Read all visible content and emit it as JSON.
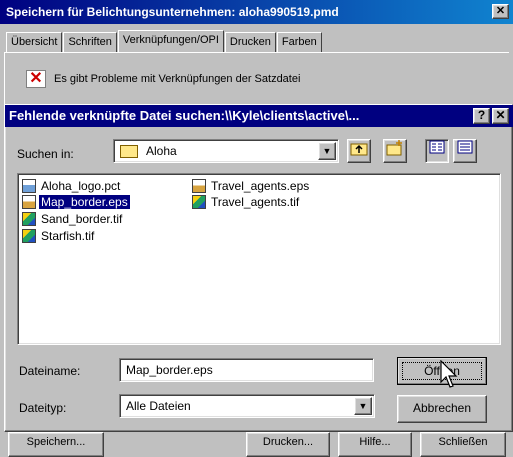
{
  "background_dialog": {
    "title": "Speichern für Belichtungsunternehmen: aloha990519.pmd",
    "close_glyph": "✕",
    "tabs": [
      {
        "label": "Übersicht"
      },
      {
        "label": "Schriften"
      },
      {
        "label": "Verknüpfungen/OPI",
        "active": true
      },
      {
        "label": "Drucken"
      },
      {
        "label": "Farben"
      }
    ],
    "warning_text": "Es gibt Probleme mit Verknüpfungen der Satzdatei",
    "warning_icon": "✕",
    "bottom_buttons": [
      {
        "label": "Speichern..."
      },
      {
        "label": "Drucken..."
      },
      {
        "label": "Hilfe..."
      },
      {
        "label": "Schließen"
      }
    ]
  },
  "dialog": {
    "title": "Fehlende verknüpfte Datei suchen:\\\\Kyle\\clients\\active\\...",
    "help_glyph": "?",
    "close_glyph": "✕",
    "look_in_label": "Suchen in:",
    "look_in_value": "Aloha",
    "combo_arrow": "▼",
    "files": [
      {
        "name": "Aloha_logo.pct",
        "icon": "pct-file-icon",
        "selected": false
      },
      {
        "name": "Map_border.eps",
        "icon": "eps-file-icon",
        "selected": true
      },
      {
        "name": "Sand_border.tif",
        "icon": "tif-file-icon",
        "selected": false
      },
      {
        "name": "Starfish.tif",
        "icon": "tif-file-icon",
        "selected": false
      },
      {
        "name": "Travel_agents.eps",
        "icon": "eps-file-icon",
        "selected": false
      },
      {
        "name": "Travel_agents.tif",
        "icon": "tif-file-icon",
        "selected": false
      }
    ],
    "filename_label": "Dateiname:",
    "filename_value": "Map_border.eps",
    "filetype_label": "Dateityp:",
    "filetype_value": "Alle Dateien",
    "open_label": "Öffnen",
    "cancel_label": "Abbrechen"
  },
  "colors": {
    "titlebar": "#000080",
    "face": "#c0c0c0",
    "selection": "#000080",
    "warning": "#cc0000"
  }
}
